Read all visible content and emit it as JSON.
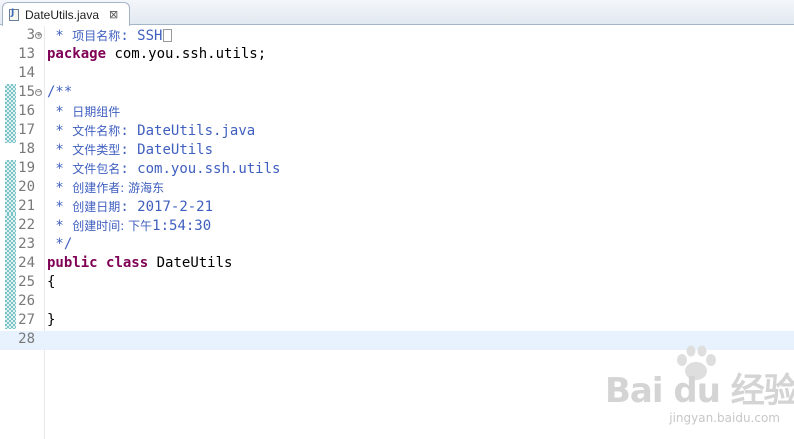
{
  "tab": {
    "file_name": "DateUtils.java",
    "close_glyph": "⊠",
    "icon": "java-file-icon"
  },
  "lines": [
    {
      "n": "3",
      "fold": "expand",
      "tokens": [
        {
          "t": " * ",
          "c": "cm"
        },
        {
          "t": "项目名称",
          "c": "cjk"
        },
        {
          "t": ": SSH",
          "c": "cm"
        }
      ]
    },
    {
      "n": "13",
      "tokens": [
        {
          "t": "package",
          "c": "kw"
        },
        {
          "t": " com.you.ssh.utils;",
          "c": "pl"
        }
      ]
    },
    {
      "n": "14",
      "tokens": []
    },
    {
      "n": "15",
      "fold": "collapse",
      "tokens": [
        {
          "t": "/**",
          "c": "cm"
        }
      ]
    },
    {
      "n": "16",
      "tokens": [
        {
          "t": " * ",
          "c": "cm"
        },
        {
          "t": "日期组件",
          "c": "cjk"
        }
      ]
    },
    {
      "n": "17",
      "tokens": [
        {
          "t": " * ",
          "c": "cm"
        },
        {
          "t": "文件名称",
          "c": "cjk"
        },
        {
          "t": ": DateUtils.java",
          "c": "cm"
        }
      ]
    },
    {
      "n": "18",
      "tokens": [
        {
          "t": " * ",
          "c": "cm"
        },
        {
          "t": "文件类型",
          "c": "cjk"
        },
        {
          "t": ": DateUtils",
          "c": "cm"
        }
      ]
    },
    {
      "n": "19",
      "tokens": [
        {
          "t": " * ",
          "c": "cm"
        },
        {
          "t": "文件包名",
          "c": "cjk"
        },
        {
          "t": ": com.you.ssh.utils",
          "c": "cm"
        }
      ]
    },
    {
      "n": "20",
      "tokens": [
        {
          "t": " * ",
          "c": "cm"
        },
        {
          "t": "创建作者: 游海东",
          "c": "cjk"
        }
      ]
    },
    {
      "n": "21",
      "tokens": [
        {
          "t": " * ",
          "c": "cm"
        },
        {
          "t": "创建日期",
          "c": "cjk"
        },
        {
          "t": ": 2017-2-21",
          "c": "cm"
        }
      ]
    },
    {
      "n": "22",
      "tokens": [
        {
          "t": " * ",
          "c": "cm"
        },
        {
          "t": "创建时间: 下午",
          "c": "cjk"
        },
        {
          "t": "1:54:30",
          "c": "cm"
        }
      ]
    },
    {
      "n": "23",
      "tokens": [
        {
          "t": " */",
          "c": "cm"
        }
      ]
    },
    {
      "n": "24",
      "tokens": [
        {
          "t": "public",
          "c": "kw"
        },
        {
          "t": " ",
          "c": "pl"
        },
        {
          "t": "class",
          "c": "kw"
        },
        {
          "t": " DateUtils",
          "c": "pl"
        }
      ]
    },
    {
      "n": "25",
      "tokens": [
        {
          "t": "{",
          "c": "pl"
        }
      ]
    },
    {
      "n": "26",
      "tokens": []
    },
    {
      "n": "27",
      "tokens": [
        {
          "t": "}",
          "c": "pl"
        }
      ]
    },
    {
      "n": "28",
      "current": true,
      "tokens": []
    }
  ],
  "watermark": {
    "brand": "Bai du 经验",
    "site": "jingyan.baidu.com"
  },
  "colors": {
    "keyword": "#7f0055",
    "javadoc": "#3f5fbf",
    "line_number": "#787878",
    "current_line": "#e8f2fe",
    "change_ruler": "#7cc3c6"
  }
}
